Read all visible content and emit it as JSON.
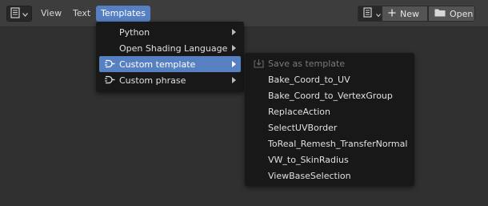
{
  "header": {
    "editor_type_icon": "text-editor-icon",
    "menus": [
      "View",
      "Text",
      "Templates"
    ],
    "new_label": "New",
    "open_label": "Open"
  },
  "templates_menu": {
    "items": [
      {
        "label": "Python",
        "has_submenu": true,
        "icon": null
      },
      {
        "label": "Open Shading Language",
        "has_submenu": true,
        "icon": null
      },
      {
        "label": "Custom template",
        "has_submenu": true,
        "icon": "plug-icon",
        "highlighted": true
      },
      {
        "label": "Custom phrase",
        "has_submenu": true,
        "icon": "plug-icon"
      }
    ]
  },
  "custom_template_submenu": {
    "items": [
      {
        "label": "Save as template",
        "disabled": true,
        "icon": "save-template-icon"
      },
      {
        "label": "Bake_Coord_to_UV"
      },
      {
        "label": "Bake_Coord_to_VertexGroup"
      },
      {
        "label": "ReplaceAction"
      },
      {
        "label": "SelectUVBorder"
      },
      {
        "label": "ToReal_Remesh_TransferNormal"
      },
      {
        "label": "VW_to_SkinRadius"
      },
      {
        "label": "ViewBaseSelection"
      }
    ]
  },
  "colors": {
    "accent": "#5680c2",
    "header_bg": "#3d3d3d",
    "editor_bg": "#303030",
    "menu_bg": "#181818"
  }
}
